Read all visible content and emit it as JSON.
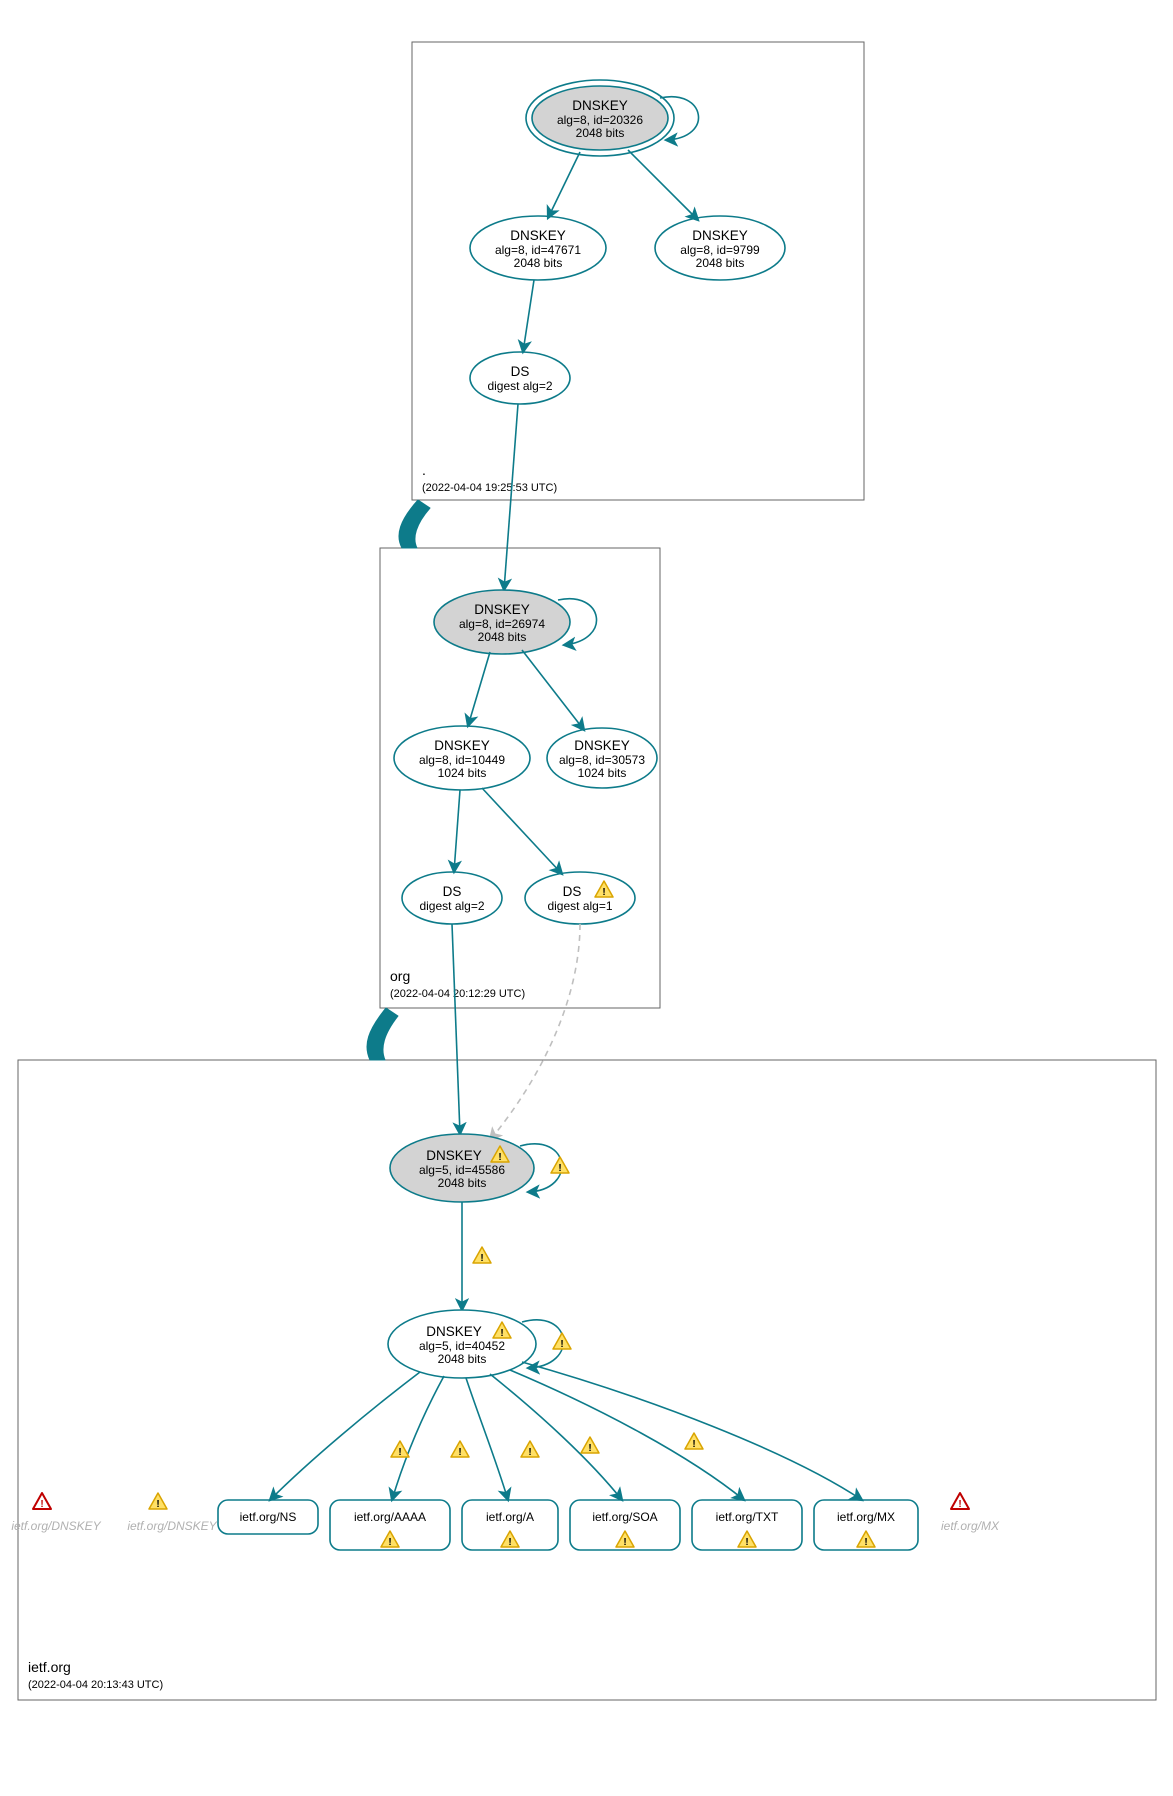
{
  "zones": {
    "root": {
      "label": ".",
      "timestamp": "(2022-04-04 19:25:53 UTC)"
    },
    "org": {
      "label": "org",
      "timestamp": "(2022-04-04 20:12:29 UTC)"
    },
    "ietf": {
      "label": "ietf.org",
      "timestamp": "(2022-04-04 20:13:43 UTC)"
    }
  },
  "nodes": {
    "root_ksk": {
      "title": "DNSKEY",
      "l1": "alg=8, id=20326",
      "l2": "2048 bits"
    },
    "root_zsk1": {
      "title": "DNSKEY",
      "l1": "alg=8, id=47671",
      "l2": "2048 bits"
    },
    "root_zsk2": {
      "title": "DNSKEY",
      "l1": "alg=8, id=9799",
      "l2": "2048 bits"
    },
    "root_ds": {
      "title": "DS",
      "l1": "digest alg=2"
    },
    "org_ksk": {
      "title": "DNSKEY",
      "l1": "alg=8, id=26974",
      "l2": "2048 bits"
    },
    "org_zsk1": {
      "title": "DNSKEY",
      "l1": "alg=8, id=10449",
      "l2": "1024 bits"
    },
    "org_zsk2": {
      "title": "DNSKEY",
      "l1": "alg=8, id=30573",
      "l2": "1024 bits"
    },
    "org_ds2": {
      "title": "DS",
      "l1": "digest alg=2"
    },
    "org_ds1": {
      "title": "DS",
      "l1": "digest alg=1"
    },
    "ietf_ksk": {
      "title": "DNSKEY",
      "l1": "alg=5, id=45586",
      "l2": "2048 bits"
    },
    "ietf_zsk": {
      "title": "DNSKEY",
      "l1": "alg=5, id=40452",
      "l2": "2048 bits"
    },
    "rr_ns": {
      "label": "ietf.org/NS"
    },
    "rr_aaaa": {
      "label": "ietf.org/AAAA"
    },
    "rr_a": {
      "label": "ietf.org/A"
    },
    "rr_soa": {
      "label": "ietf.org/SOA"
    },
    "rr_txt": {
      "label": "ietf.org/TXT"
    },
    "rr_mx": {
      "label": "ietf.org/MX"
    },
    "faded_dnskey1": {
      "label": "ietf.org/DNSKEY"
    },
    "faded_dnskey2": {
      "label": "ietf.org/DNSKEY"
    },
    "faded_mx": {
      "label": "ietf.org/MX"
    }
  }
}
